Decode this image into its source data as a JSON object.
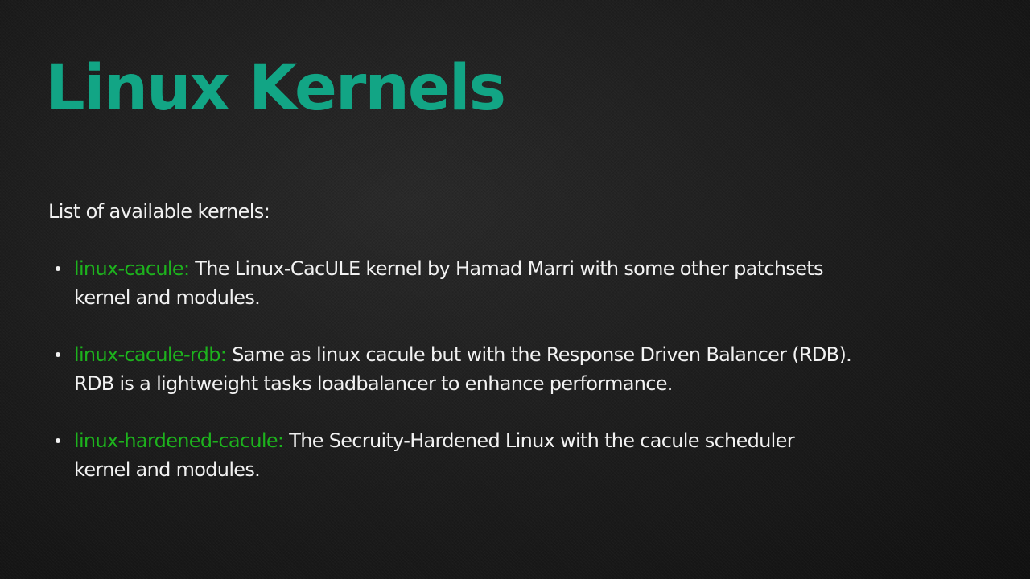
{
  "slide": {
    "title": "Linux Kernels",
    "intro": "List of available kernels:",
    "kernels": [
      {
        "name": "linux-cacule:",
        "description": "The Linux-CacULE kernel by Hamad Marri with some other patchsets kernel and modules."
      },
      {
        "name": "linux-cacule-rdb:",
        "description": "Same as linux cacule but with the Response Driven Balancer (RDB). RDB is a lightweight tasks loadbalancer to enhance performance."
      },
      {
        "name": "linux-hardened-cacule:",
        "description": "The Secruity-Hardened Linux with the cacule scheduler kernel and modules."
      }
    ]
  },
  "colors": {
    "title": "#12a585",
    "kernel_name": "#1db31d",
    "text": "#f2f2f2",
    "background": "#1c1c1c"
  }
}
